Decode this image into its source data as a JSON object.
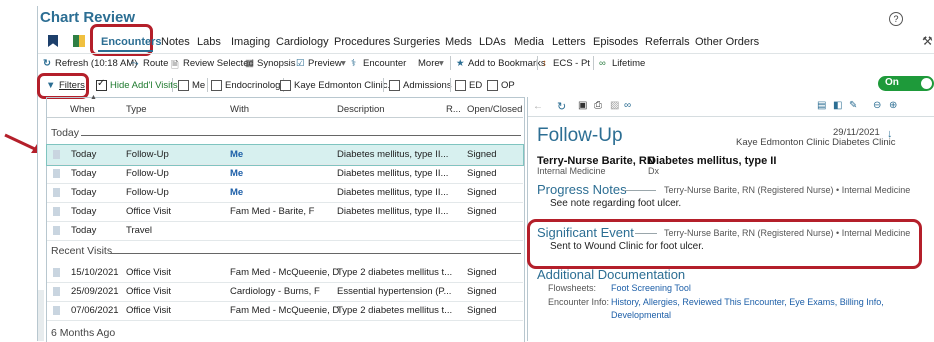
{
  "title": "Chart Review",
  "help_icon": "?",
  "tabs": [
    "Encounters",
    "Notes",
    "Labs",
    "Imaging",
    "Cardiology",
    "Procedures",
    "Surgeries",
    "Meds",
    "LDAs",
    "Media",
    "Letters",
    "Episodes",
    "Referrals",
    "Other Orders"
  ],
  "toolbar": {
    "refresh": "Refresh (10:18 AM)",
    "route": "Route",
    "review": "Review Selected",
    "synopsis": "Synopsis",
    "preview": "Preview",
    "encounter": "Encounter",
    "more": "More",
    "bookmarks": "Add to Bookmarks",
    "ecs": "ECS - Pt",
    "lifetime": "Lifetime"
  },
  "filters": {
    "filters_label": "Filters",
    "hide_label": "Hide Add'l Visits",
    "me": "Me",
    "endocrinology": "Endocrinology",
    "clinic": "Kaye Edmonton Clinic...",
    "admissions": "Admissions",
    "ed": "ED",
    "op": "OP",
    "toggle": "On"
  },
  "table": {
    "headers": [
      "When",
      "Type",
      "With",
      "Description",
      "R...",
      "Open/Closed"
    ],
    "groups": [
      "Today",
      "Recent Visits",
      "6 Months Ago"
    ],
    "today_rows": [
      {
        "when": "Today",
        "type": "Follow-Up",
        "with": "Me",
        "desc": "Diabetes mellitus, type II...",
        "status": "Signed"
      },
      {
        "when": "Today",
        "type": "Follow-Up",
        "with": "Me",
        "desc": "Diabetes mellitus, type II...",
        "status": "Signed"
      },
      {
        "when": "Today",
        "type": "Follow-Up",
        "with": "Me",
        "desc": "Diabetes mellitus, type II...",
        "status": "Signed"
      },
      {
        "when": "Today",
        "type": "Office Visit",
        "with": "Fam Med - Barite, F",
        "desc": "Diabetes mellitus, type II...",
        "status": "Signed"
      },
      {
        "when": "Today",
        "type": "Travel",
        "with": "",
        "desc": "",
        "status": ""
      }
    ],
    "recent_rows": [
      {
        "when": "15/10/2021",
        "type": "Office Visit",
        "with": "Fam Med - McQueenie, D",
        "desc": "Type 2 diabetes mellitus t...",
        "status": "Signed"
      },
      {
        "when": "25/09/2021",
        "type": "Office Visit",
        "with": "Cardiology - Burns, F",
        "desc": "Essential hypertension (P...",
        "status": "Signed"
      },
      {
        "when": "07/06/2021",
        "type": "Office Visit",
        "with": "Fam Med - McQueenie, D",
        "desc": "Type 2 diabetes mellitus t...",
        "status": "Signed"
      }
    ]
  },
  "note": {
    "title": "Follow-Up",
    "date": "29/11/2021",
    "clinic": "Kaye Edmonton Clinic Diabetes Clinic",
    "author": "Terry-Nurse Barite, RN",
    "author_dept": "Internal Medicine",
    "dx": "Diabetes mellitus, type II",
    "dx_label": "Dx",
    "progress_title": "Progress Notes",
    "progress_meta": "Terry-Nurse Barite, RN (Registered Nurse) • Internal Medicine",
    "progress_text": "See note regarding foot ulcer.",
    "event_title": "Significant Event",
    "event_meta": "Terry-Nurse Barite, RN (Registered Nurse) • Internal Medicine",
    "event_text": "Sent to Wound Clinic for foot ulcer.",
    "addl_title": "Additional Documentation",
    "flowsheets_label": "Flowsheets:",
    "flowsheets_value": "Foot Screening Tool",
    "encinfo_label": "Encounter Info:",
    "encinfo_value": "History, Allergies, Reviewed This Encounter, Eye Exams, Billing Info,",
    "encinfo_value2": "Developmental"
  },
  "colors": {
    "accent": "#2c6e93",
    "annotation": "#b41f2a",
    "toggle": "#1e9a3a",
    "selected_row": "#d7f0ef"
  }
}
